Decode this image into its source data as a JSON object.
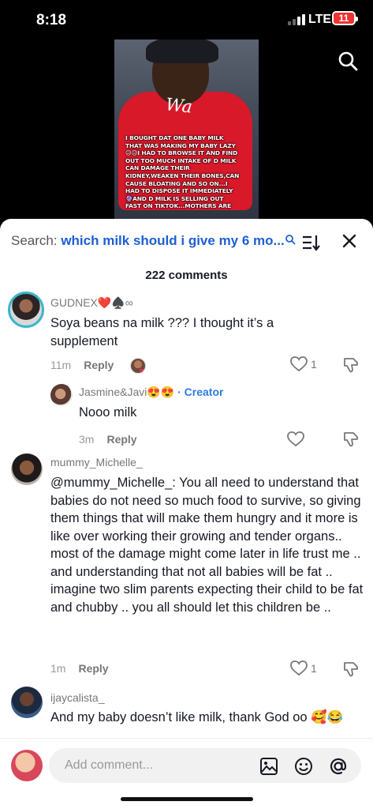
{
  "status": {
    "time": "8:18",
    "network": "LTE",
    "battery": "11"
  },
  "video": {
    "shirt_text": "Wa",
    "caption": "I BOUGHT DAT ONE BABY MILK\nTHAT WAS MAKING MY BABY LAZY\n😥😥I HAD TO BROWSE IT AND FIND\nOUT TOO MUCH INTAKE OF D MILK\nCAN DAMAGE THEIR\nKIDNEY,WEAKEN THEIR BONES,CAN\nCAUSE BLOATING AND SO ON...I\nHAD TO DISPOSE IT IMMEDIATELY\n🔮AND D MILK IS SELLING OUT\nFAST ON TIKTOK...MOTHERS ARE"
  },
  "search": {
    "prefix": "Search: ",
    "query": "which milk should i give my 6 mo..."
  },
  "comments_count": "222 comments",
  "comments": [
    {
      "username": "GUDNEX❤️♠️∞",
      "text": "Soya beans na milk ??? I thought it’s a supplement",
      "time": "11m",
      "reply_label": "Reply",
      "likes": "1"
    },
    {
      "username": "Jasmine&Javi😍😍",
      "creator_label": "· Creator",
      "text": "Nooo milk",
      "time": "3m",
      "reply_label": "Reply"
    },
    {
      "username": "mummy_Michelle_",
      "text": "@mummy_Michelle_: You all need to understand that babies do not need so much food to survive, so giving them things that will make them hungry and it more is like over working their growing and tender organs.. most of the damage might come later in life trust me .. and understanding that not all babies will be fat .. imagine two slim parents expecting their child to be fat and chubby .. you all should let this children be ..",
      "time": "1m",
      "reply_label": "Reply",
      "likes": "1"
    },
    {
      "username": "ijaycalista_",
      "text": "And my baby doesn’t like milk, thank God oo 🥰😂"
    }
  ],
  "composer": {
    "placeholder": "Add comment..."
  },
  "icons": {
    "search": "search-icon",
    "sort": "sort-icon",
    "close": "close-icon",
    "like": "heart-icon",
    "dislike": "thumbs-down-icon",
    "image": "image-icon",
    "emoji": "emoji-icon",
    "mention": "at-icon"
  }
}
